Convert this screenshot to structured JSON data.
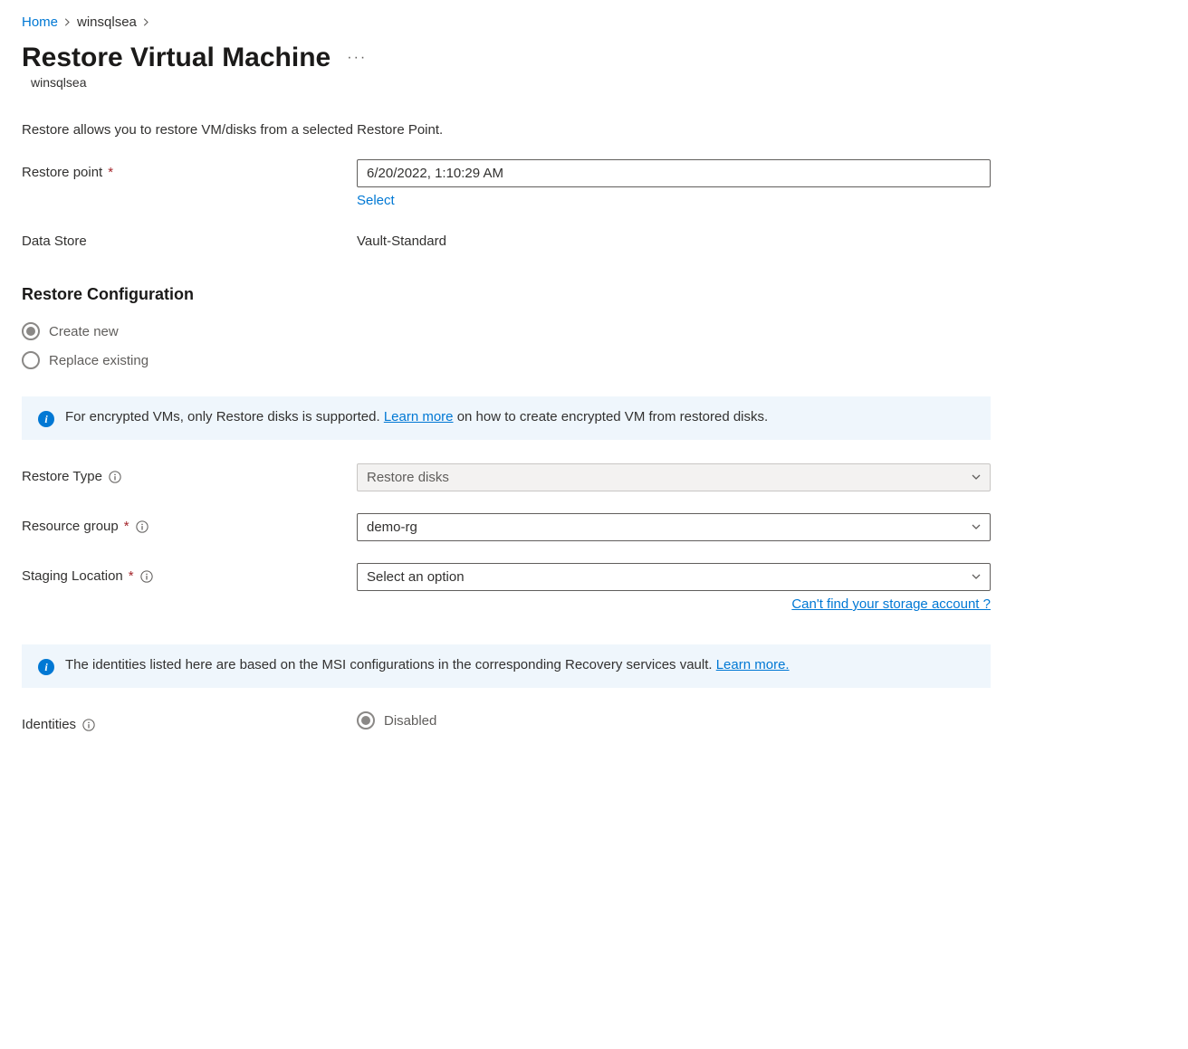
{
  "breadcrumb": {
    "home": "Home",
    "item": "winsqlsea"
  },
  "page": {
    "title": "Restore Virtual Machine",
    "subtitle": "winsqlsea",
    "description": "Restore allows you to restore VM/disks from a selected Restore Point."
  },
  "fields": {
    "restore_point": {
      "label": "Restore point",
      "value": "6/20/2022, 1:10:29 AM",
      "select_link": "Select"
    },
    "data_store": {
      "label": "Data Store",
      "value": "Vault-Standard"
    },
    "restore_type": {
      "label": "Restore Type",
      "value": "Restore disks"
    },
    "resource_group": {
      "label": "Resource group",
      "value": "demo-rg"
    },
    "staging_location": {
      "label": "Staging Location",
      "placeholder": "Select an option",
      "help_link": "Can't find your storage account ?"
    },
    "identities": {
      "label": "Identities",
      "value": "Disabled"
    }
  },
  "restore_config": {
    "title": "Restore Configuration",
    "create_new": "Create new",
    "replace_existing": "Replace existing",
    "selected": "create_new"
  },
  "infobox1": {
    "text_before": "For encrypted VMs, only Restore disks is supported. ",
    "link": "Learn more",
    "text_after": " on how to create encrypted VM from restored disks."
  },
  "infobox2": {
    "text_before": "The identities listed here are based on the MSI configurations in the corresponding Recovery services vault. ",
    "link": "Learn more."
  }
}
